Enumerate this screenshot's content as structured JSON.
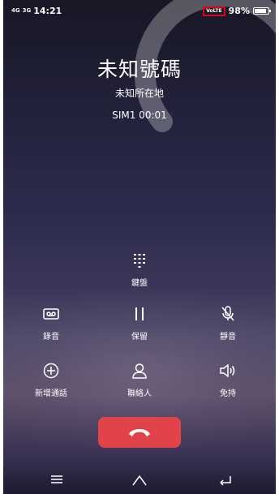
{
  "status": {
    "time": "14:21",
    "net1": "4G",
    "net2": "3G",
    "volte": "VoLTE",
    "battery": "98%",
    "battery_level": 0.98
  },
  "call": {
    "caller": "未知號碼",
    "location": "未知所在地",
    "timer": "SIM1  00:01"
  },
  "controls": {
    "keypad": "鍵盤",
    "record": "錄音",
    "hold": "保留",
    "mute": "靜音",
    "add_call": "新增通話",
    "contacts": "聯絡人",
    "speaker": "免持"
  },
  "colors": {
    "hangup": "#e0444a",
    "highlight_box": "#e0001a"
  }
}
